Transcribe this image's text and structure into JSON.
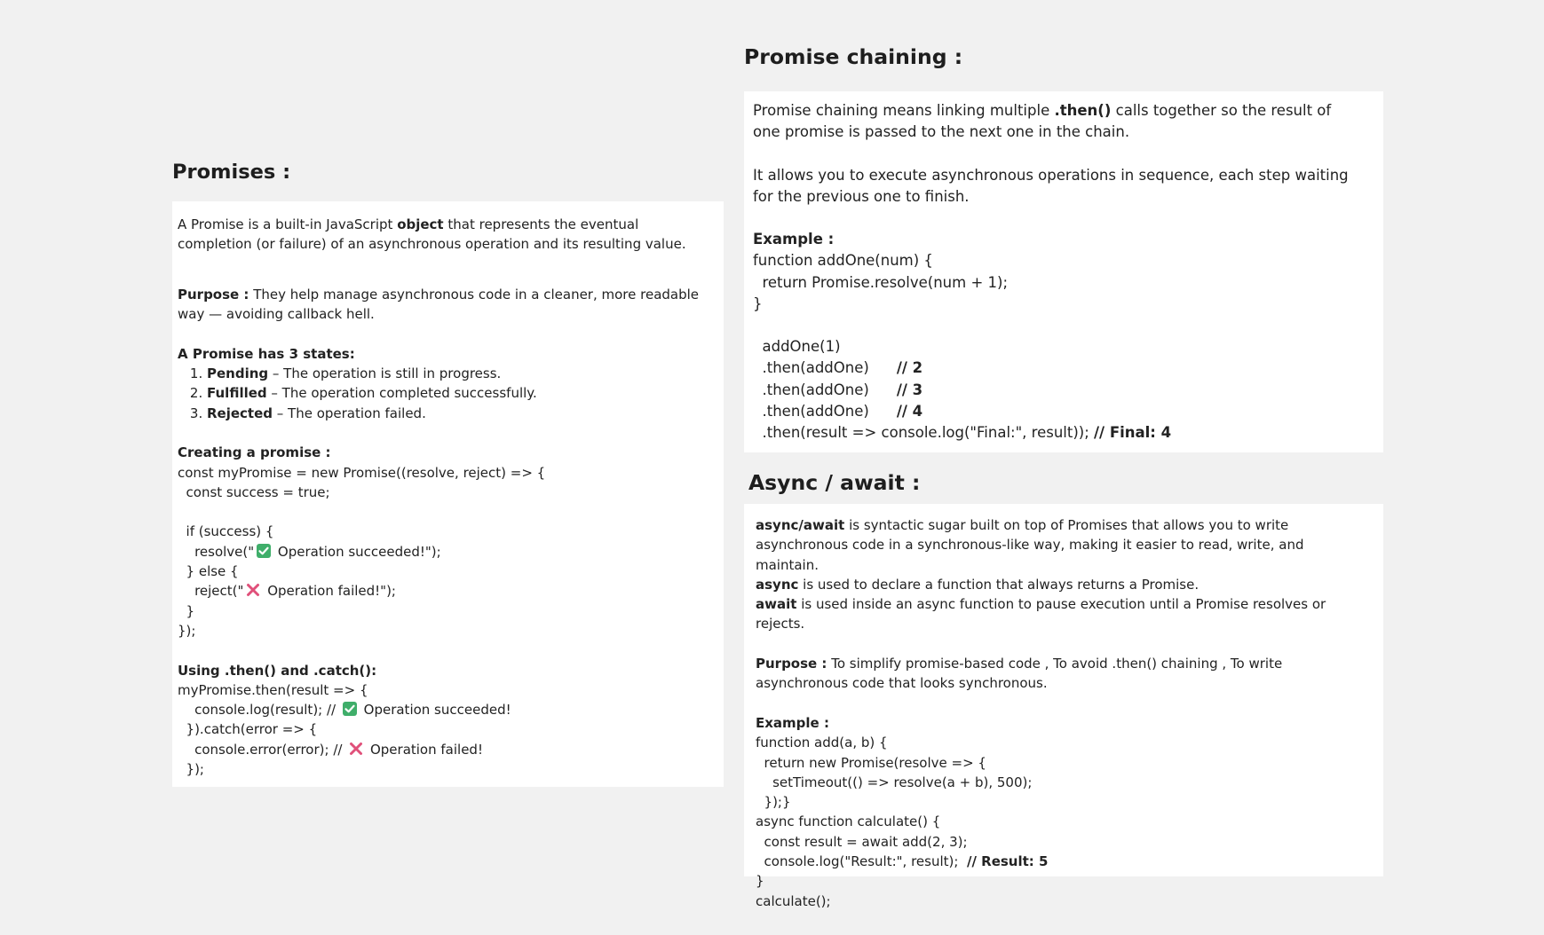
{
  "promises": {
    "heading": "Promises :",
    "intro_pre": "A Promise is a built-in JavaScript ",
    "intro_bold": "object",
    "intro_post": " that represents the eventual completion (or failure) of an asynchronous operation and its resulting value.",
    "purpose_label": "Purpose :",
    "purpose_text": "  They help manage asynchronous code in a cleaner, more readable way — avoiding callback hell.",
    "states_heading": "A Promise has 3 states:",
    "states": [
      {
        "name": "Pending",
        "desc": " – The operation is still in progress."
      },
      {
        "name": "Fulfilled",
        "desc": " – The operation completed successfully."
      },
      {
        "name": "Rejected",
        "desc": " – The operation failed."
      }
    ],
    "creating_heading": "Creating a promise :",
    "create_code_1": "const myPromise = new Promise((resolve, reject) => {",
    "create_code_2": "  const success = true;",
    "create_code_3": "  if (success) {",
    "create_code_4_pre": "    resolve(\"",
    "create_code_4_post": " Operation succeeded!\");",
    "create_code_5": "  } else {",
    "create_code_6_pre": "    reject(\"",
    "create_code_6_post": " Operation failed!\");",
    "create_code_7": "  }",
    "create_code_8": "});",
    "using_heading": "Using .then() and .catch():",
    "using_code_1": "myPromise.then(result => {",
    "using_code_2_pre": "    console.log(result); // ",
    "using_code_2_post": " Operation succeeded!",
    "using_code_3": "  }).catch(error => {",
    "using_code_4_pre": "    console.error(error); // ",
    "using_code_4_post": " Operation failed!",
    "using_code_5": "  });"
  },
  "chaining": {
    "heading": "Promise chaining :",
    "p1_pre": "Promise chaining means linking multiple ",
    "p1_bold": ".then()",
    "p1_post": " calls together so the result of one promise is passed to the next one in the chain.",
    "p2": "It allows you to execute asynchronous operations in sequence, each step waiting for the previous one to finish.",
    "example_label": "Example :",
    "code_1": "function addOne(num) {",
    "code_2": "  return Promise.resolve(num + 1);",
    "code_3": "}",
    "code_4": "  addOne(1)",
    "code_5": "  .then(addOne)",
    "code_5_comment": "// 2",
    "code_6": "  .then(addOne)",
    "code_6_comment": "// 3",
    "code_7": "  .then(addOne)",
    "code_7_comment": "// 4",
    "code_8": "  .then(result => console.log(\"Final:\", result)); ",
    "code_8_comment": "// Final: 4"
  },
  "async": {
    "heading": "Async / await :",
    "l1_bold": "async/await",
    "l1_text": " is syntactic sugar built on top of Promises that allows you to write asynchronous code in a synchronous-like way, making it easier to read, write, and maintain.",
    "l2_bold": "async",
    "l2_text": " is used to declare a function that always returns a Promise.",
    "l3_bold": "await",
    "l3_text": " is used inside an async function to pause execution until a Promise resolves or rejects.",
    "purpose_label": "Purpose :",
    "purpose_text": "  To simplify promise-based code , To avoid .then() chaining , To write asynchronous code that looks synchronous.",
    "example_label": "Example :",
    "code_1": "function add(a, b) {",
    "code_2": "  return new Promise(resolve => {",
    "code_3": "    setTimeout(() => resolve(a + b), 500);",
    "code_4": "  });}",
    "code_5": "async function calculate() {",
    "code_6": "  const result = await add(2, 3);",
    "code_7": "  console.log(\"Result:\", result);  ",
    "code_7_comment": "// Result: 5",
    "code_8": "}",
    "code_9": "calculate();"
  },
  "icons": {
    "check": "check-mark-emoji-icon",
    "cross": "cross-mark-emoji-icon"
  },
  "colors": {
    "background": "#f1f1f1",
    "card": "#ffffff",
    "check_green": "#3fae6a",
    "cross_pink": "#e0507a"
  }
}
